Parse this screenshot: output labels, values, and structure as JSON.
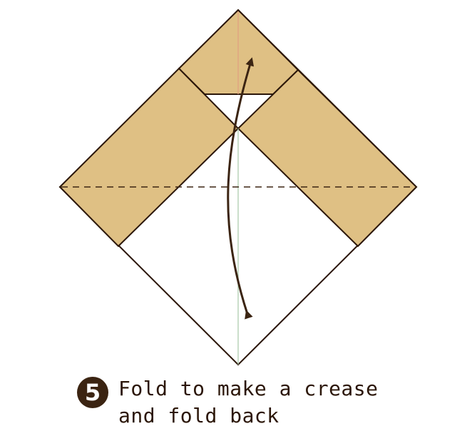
{
  "step": {
    "number": "5",
    "badge_color": "#3b2412"
  },
  "instruction": {
    "line1": "Fold to make a crease",
    "line2": "and fold back"
  },
  "colors": {
    "paper_tan": "#dfc084",
    "outline": "#2b1608",
    "arrow": "#3b2412",
    "center_crease": "#a8c8a8",
    "upper_crease": "#e0a080",
    "fold_line": "#3b2412"
  },
  "annotations": {
    "fold_line_style": "dashed",
    "arrow_type": "fold-and-unfold"
  }
}
